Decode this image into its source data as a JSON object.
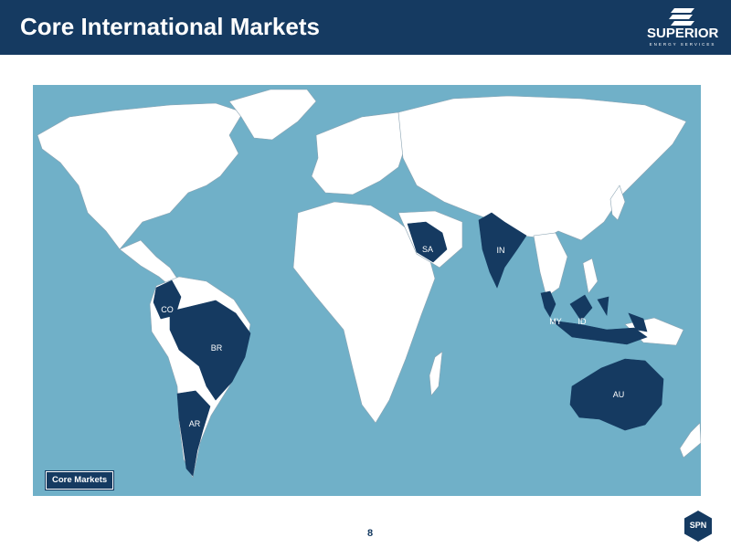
{
  "header": {
    "title": "Core International Markets"
  },
  "logo": {
    "name": "SUPERIOR",
    "subtitle": "ENERGY SERVICES"
  },
  "map": {
    "legend": "Core Markets",
    "colors": {
      "ocean": "#70b0c8",
      "land": "#ffffff",
      "core_market": "#153a61"
    },
    "markets": [
      {
        "code": "CO"
      },
      {
        "code": "BR"
      },
      {
        "code": "AR"
      },
      {
        "code": "SA"
      },
      {
        "code": "IN"
      },
      {
        "code": "MY"
      },
      {
        "code": "ID"
      },
      {
        "code": "AU"
      }
    ]
  },
  "footer": {
    "page_number": "8",
    "badge": "SPN"
  }
}
